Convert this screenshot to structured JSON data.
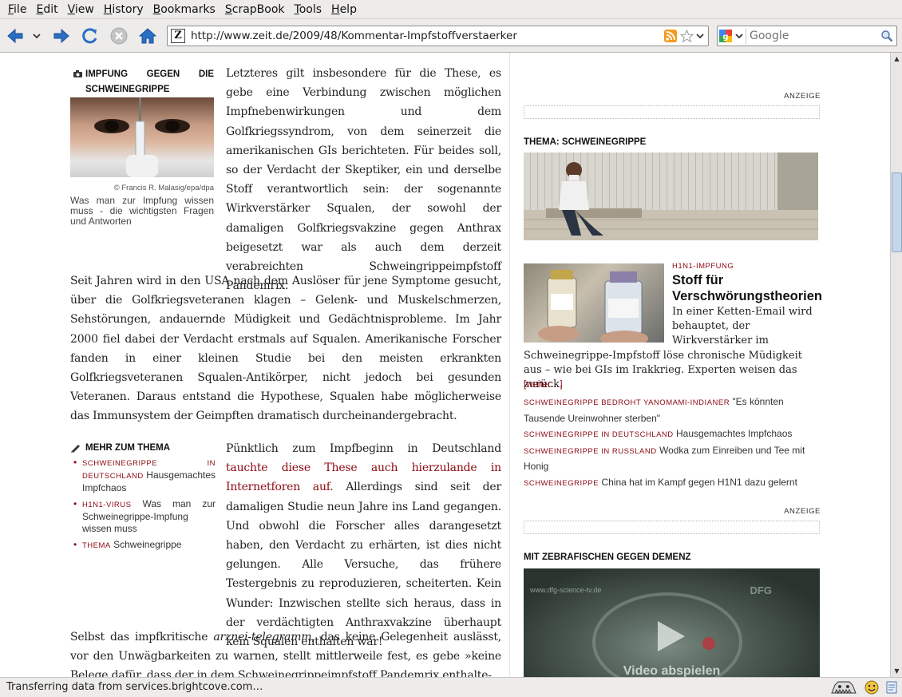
{
  "menu": [
    "File",
    "Edit",
    "View",
    "History",
    "Bookmarks",
    "ScrapBook",
    "Tools",
    "Help"
  ],
  "url": "http://www.zeit.de/2009/48/Kommentar-Impfstoffverstaerker",
  "search_placeholder": "Google",
  "article": {
    "infobox": {
      "title": "IMPFUNG GEGEN DIE SCHWEINEGRIPPE",
      "credit": "© Francis R. Malasig/epa/dpa",
      "caption": "Was man zur Impfung wissen muss - die wichtigsten Fragen und Antworten"
    },
    "para1": "Letzteres gilt insbesondere für die These, es gebe eine Verbindung zwischen möglichen Impfnebenwirkungen und dem Golfkriegssyndrom, von dem seinerzeit die amerikanischen GIs berichteten. Für beides soll, so der Verdacht der Skeptiker, ein und derselbe Stoff verantwortlich sein: der sogenannte Wirkverstärker Squalen, der sowohl der damaligen Golfkriegsvakzine gegen Anthrax beigesetzt war als auch dem derzeit verabreichten Schweingrippeimpfstoff Pandemrix.",
    "para2": "Seit Jahren wird in den USA nach dem Auslöser für jene Symptome gesucht, über die Golfkriegsveteranen klagen – Gelenk- und Muskelschmerzen, Sehstörungen, andauernde Müdigkeit und Gedächtnisprobleme. Im Jahr 2000 fiel dabei der Verdacht erstmals auf Squalen. Amerikanische Forscher fanden in einer kleinen Studie bei den meisten erkrankten Golfkriegsveteranen Squalen-Antikörper, nicht jedoch bei gesunden Veteranen. Daraus entstand die Hypothese, Squalen habe möglicherweise das Immunsystem der Geimpften dramatisch durcheinandergebracht.",
    "mehr": {
      "title": "MEHR ZUM THEMA",
      "items": [
        {
          "tag": "SCHWEINEGRIPPE IN DEUTSCHLAND",
          "text": "Hausgemachtes Impfchaos"
        },
        {
          "tag": "H1N1-VIRUS",
          "text": "Was man zur Schweinegrippe-Impfung wissen muss"
        },
        {
          "tag": "THEMA",
          "text": "Schweinegrippe"
        }
      ]
    },
    "para3_start": "Pünktlich zum Impfbeginn in Deutschland ",
    "para3_link": "tauchte diese These auch hierzulande in Internetforen auf.",
    "para3_rest": " Allerdings sind seit der damaligen Studie neun Jahre ins Land gegangen. Und obwohl die Forscher alles darangesetzt haben, den Verdacht zu erhärten, ist dies nicht gelungen. Alle Versuche, das frühere Testergebnis zu reproduzieren, scheiterten. Kein Wunder: Inzwischen stellte sich heraus, dass in der verdächtigten Anthraxvakzine überhaupt kein Squalen enthalten war!",
    "para4_start": "Selbst das impfkritische ",
    "para4_em": "arznei-telegramm,",
    "para4_rest": " das keine Gelegenheit auslässt, vor den Unwägbarkeiten zu warnen, stellt mittlerweile fest, es gebe »keine Belege dafür, dass der in dem Schweinegrippeimpfstoff Pandemrix enthalte-"
  },
  "sidebar": {
    "anzeige": "ANZEIGE",
    "thema_title": "THEMA: SCHWEINEGRIPPE",
    "teaser": {
      "kicker": "H1N1-IMPFUNG",
      "headline": "Stoff für Verschwörungstheorien",
      "text": "In einer Ketten-Email wird behauptet, der Wirkverstärker im Schweinegrippe-Impfstoff löse chronische Müdigkeit aus – wie bei GIs im Irakkrieg. Experten weisen das zurück.",
      "more": "[weiter…]"
    },
    "links": [
      {
        "tag": "SCHWEINEGRIPPE BEDROHT YANOMAMI-INDIANER",
        "text": "\"Es könnten Tausende Ureinwohner sterben\""
      },
      {
        "tag": "SCHWEINEGRIPPE IN DEUTSCHLAND",
        "text": "Hausgemachtes Impfchaos"
      },
      {
        "tag": "SCHWEINEGRIPPE IN RUSSLAND",
        "text": "Wodka zum Einreiben und Tee mit Honig"
      },
      {
        "tag": "SCHWEINEGRIPPE",
        "text": "China hat im Kampf gegen H1N1 dazu gelernt"
      }
    ],
    "video_title": "MIT ZEBRAFISCHEN GEGEN DEMENZ",
    "video_url_text": "www.dfg-science-tv.de",
    "video_logo": "DFG",
    "video_play": "Video abspielen"
  },
  "status": "Transferring data from services.brightcove.com…",
  "colors": {
    "accent_red": "#8b0a12",
    "nav_blue": "#2a6fc4"
  }
}
